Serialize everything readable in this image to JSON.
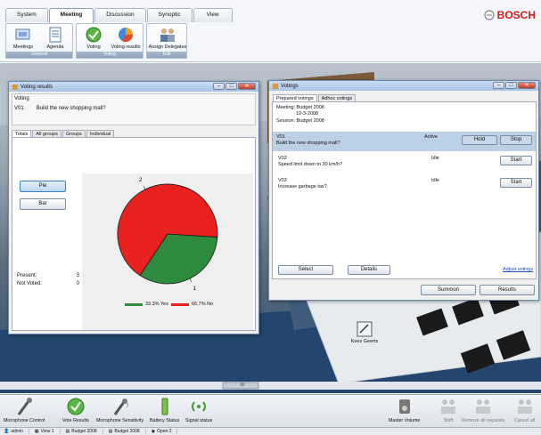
{
  "ribbon": {
    "tabs": [
      "System",
      "Meeting",
      "Discussion",
      "Synoptic",
      "View"
    ],
    "groups": [
      {
        "caption": "General",
        "items": [
          "Meetings",
          "Agenda"
        ]
      },
      {
        "caption": "Voting",
        "items": [
          "Voting",
          "Voting results"
        ]
      },
      {
        "caption": "Edit",
        "items": [
          "Assign Delegates"
        ]
      }
    ]
  },
  "brand": "BOSCH",
  "results_window": {
    "title": "Voting results",
    "section": "Voting",
    "vote_id": "V01",
    "vote_text": "Build the new shopping mall?",
    "tabs": [
      "Totals",
      "All groups",
      "Groups",
      "Individual"
    ],
    "pie_button": "Pie",
    "bar_button": "Bar",
    "present_label": "Present:",
    "present_value": "3",
    "notvoted_label": "Not Voted:",
    "notvoted_value": "0",
    "pie_label_no": "2",
    "pie_label_yes": "1",
    "legend_yes": "33.3% Yes",
    "legend_no": "66.7% No"
  },
  "chart_data": {
    "type": "pie",
    "slices": [
      {
        "label": "Yes",
        "value": 33.3,
        "count": 1,
        "color": "#2e8b3e"
      },
      {
        "label": "No",
        "value": 66.7,
        "count": 2,
        "color": "#e8201e"
      }
    ]
  },
  "votings_window": {
    "title": "Votings",
    "tabs": [
      "Prepared votings",
      "Adhoc votings"
    ],
    "meeting_label": "Meeting:",
    "meeting_value": "Budget 2008",
    "meeting_date": "19-3-2008",
    "session_label": "Session:",
    "session_value": "Budget 2008",
    "rows": [
      {
        "id": "V01",
        "text": "Build the new shopping mall?",
        "status": "Active",
        "hold": "Hold",
        "action": "Stop"
      },
      {
        "id": "V02",
        "text": "Speed limit down to 30 km/h?",
        "status": "Idle",
        "action": "Start"
      },
      {
        "id": "V03",
        "text": "Increase garbage tax?",
        "status": "Idle",
        "action": "Start"
      }
    ],
    "select_button": "Select",
    "details_button": "Details",
    "adjust_link": "Adjust votings",
    "summon_button": "Summon",
    "results_button": "Results"
  },
  "scene": {
    "seat_label": "Kees Geerts",
    "scroll_mark": "III"
  },
  "taskbar": {
    "left": [
      "Microphone Control",
      "Vote Results",
      "Microphone Sensitivity",
      "Battery Status",
      "Signal status"
    ],
    "right": [
      "Master Volume",
      "Shift",
      "Remove all requests",
      "Cancel all"
    ]
  },
  "status": {
    "user": "admin",
    "view": "View 1",
    "budget1": "Budget 2008",
    "budget2": "Budget 2008",
    "open": "Open:2"
  }
}
